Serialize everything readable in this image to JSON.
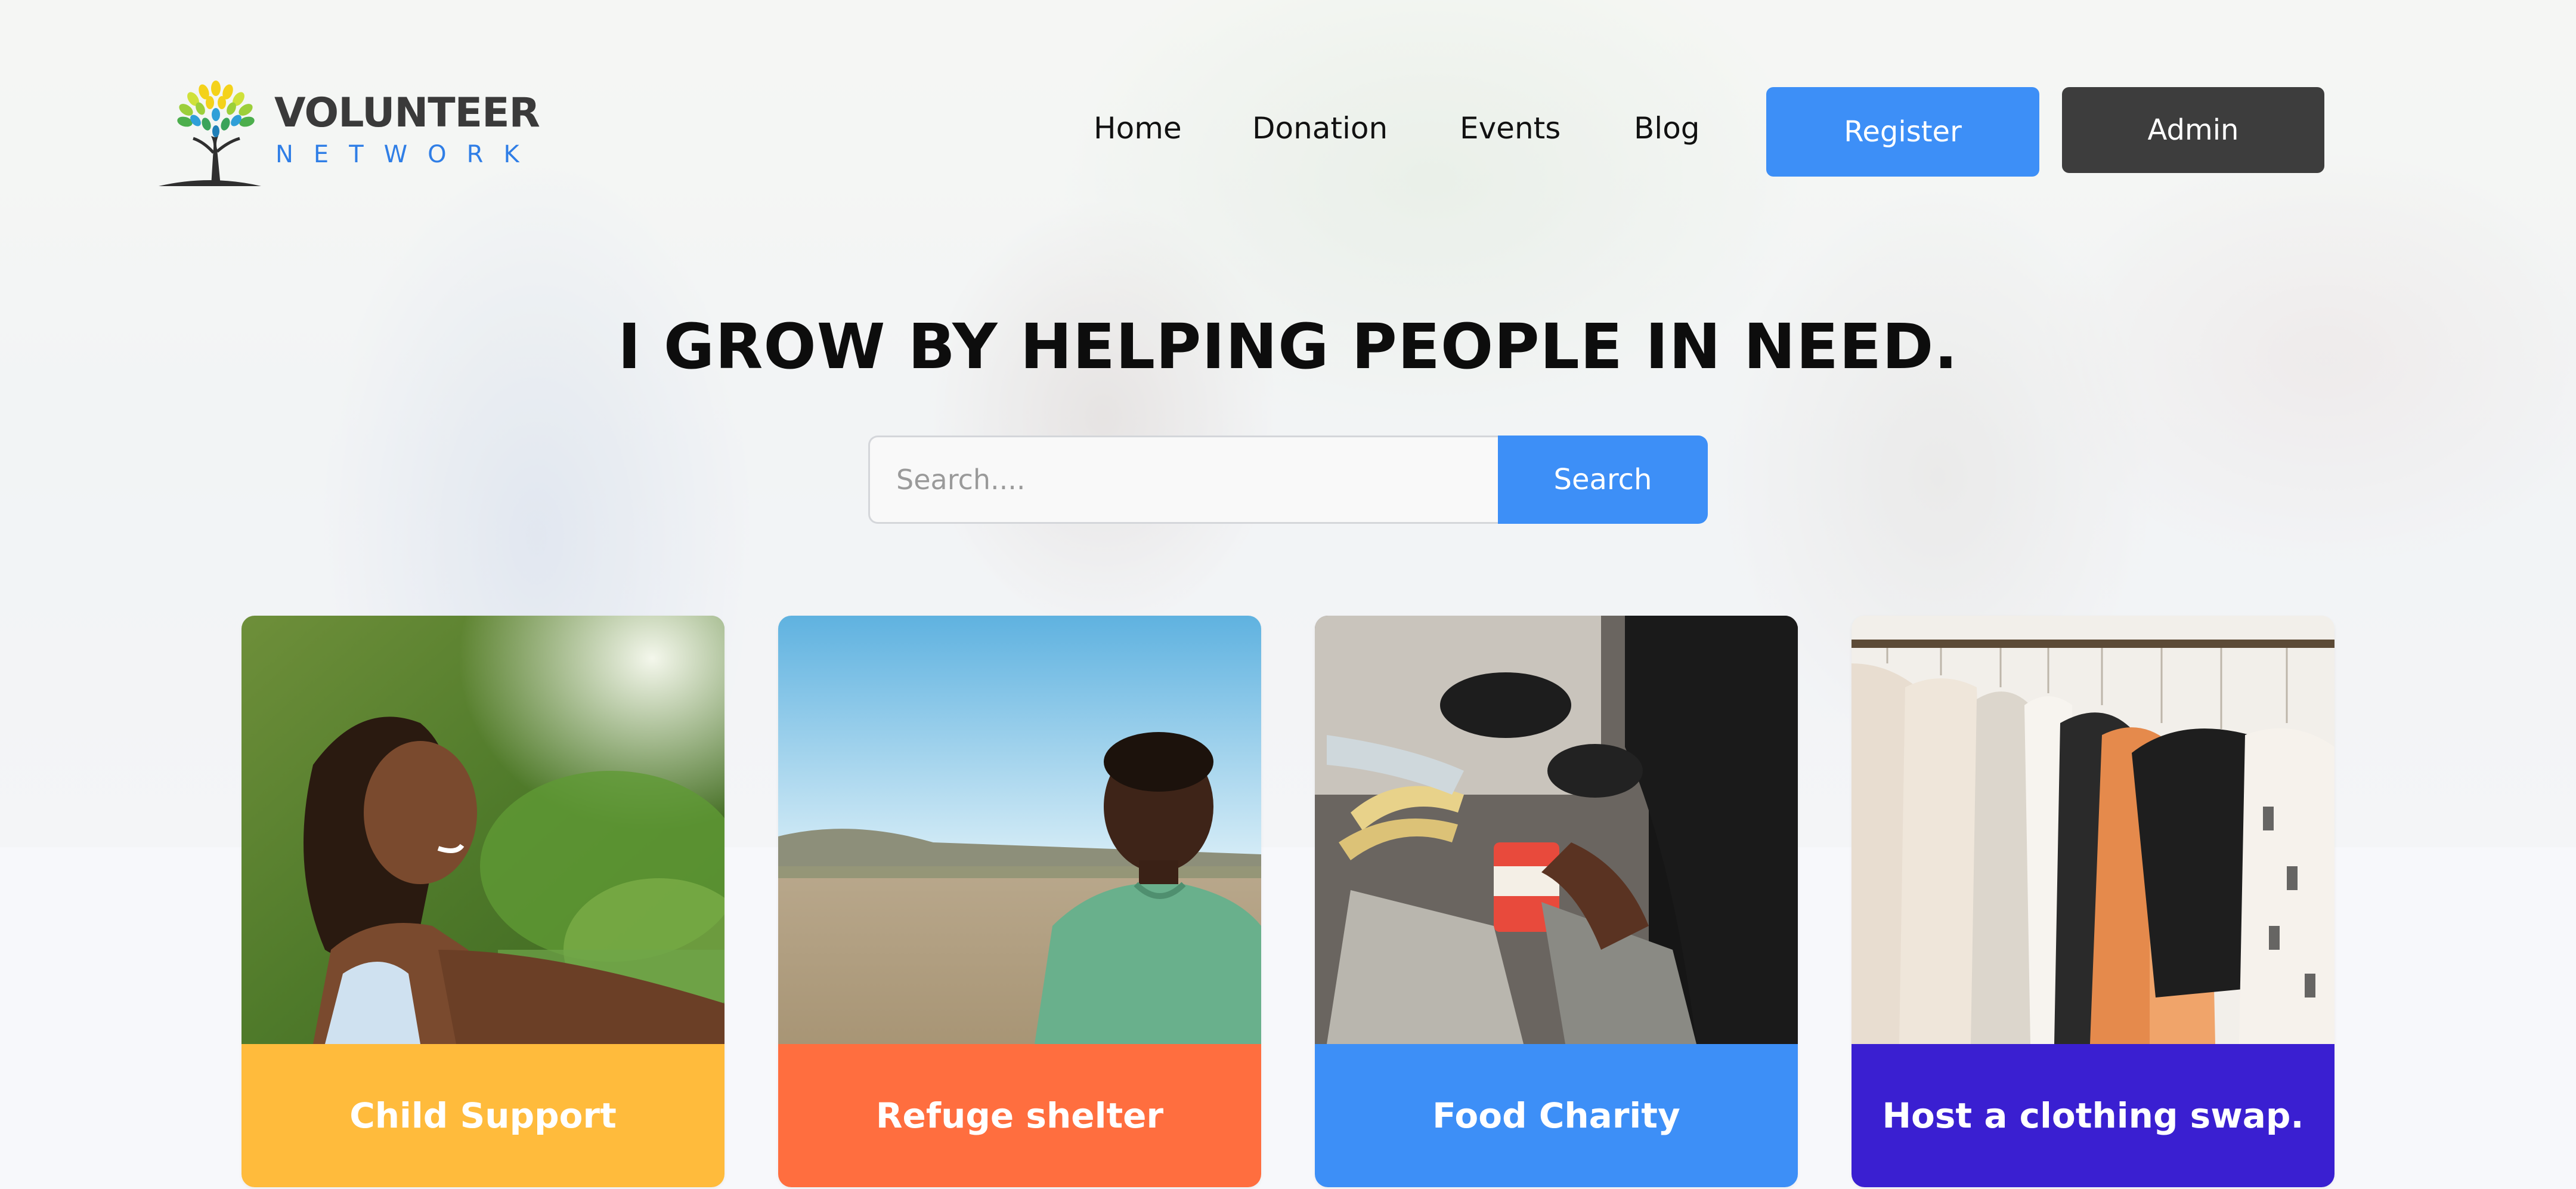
{
  "brand": {
    "name": "VOLUNTEER",
    "tagline": "NETWORK",
    "icon": "tree-icon"
  },
  "nav": {
    "items": [
      {
        "label": "Home"
      },
      {
        "label": "Donation"
      },
      {
        "label": "Events"
      },
      {
        "label": "Blog"
      }
    ],
    "register_label": "Register",
    "admin_label": "Admin"
  },
  "hero": {
    "headline": "I GROW BY HELPING PEOPLE IN NEED.",
    "search": {
      "placeholder": "Search....",
      "value": "",
      "button_label": "Search"
    }
  },
  "cards": [
    {
      "label": "Child Support",
      "color": "#ffbb3c",
      "image": "girl-smiling-outdoors"
    },
    {
      "label": "Refuge shelter",
      "color": "#ff6e3f",
      "image": "boy-in-field"
    },
    {
      "label": "Food Charity",
      "color": "#3d8ff7",
      "image": "food-donation-hands"
    },
    {
      "label": "Host a clothing swap.",
      "color": "#3a1fd1",
      "image": "clothes-on-rack"
    }
  ],
  "colors": {
    "primary": "#3d8ff7",
    "dark": "#3d3d3d",
    "brand_blue": "#2f7ee6"
  }
}
